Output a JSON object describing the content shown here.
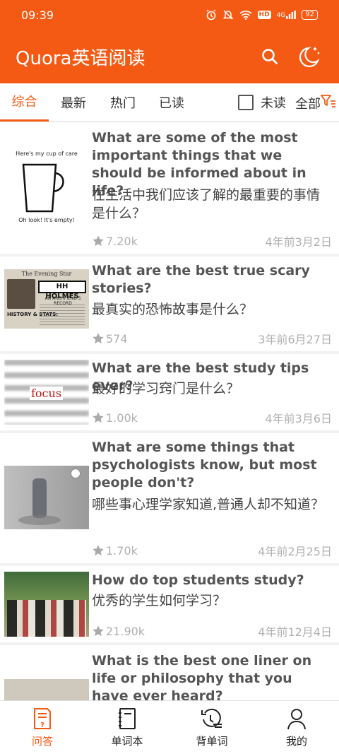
{
  "status": {
    "time": "09:39",
    "hd": "HD",
    "signal": "4G",
    "battery": "92"
  },
  "appbar": {
    "title": "Quora英语阅读",
    "search_icon": "search-icon",
    "night_icon": "moon-stars-icon"
  },
  "tabs": [
    {
      "label": "综合",
      "active": true
    },
    {
      "label": "最新"
    },
    {
      "label": "热门"
    },
    {
      "label": "已读"
    }
  ],
  "unread_label": "未读",
  "filter_label": "全部",
  "articles": [
    {
      "en": "What are some of the most important things that we should be informed about in life?",
      "zh": "在生活中我们应该了解的最重要的事情是什么？",
      "stars": "7.20k",
      "date": "4年前3月2日",
      "thumb_top": "Here's my cup of care",
      "thumb_bottom": "Oh look! It's empty!"
    },
    {
      "en": "What are the best true scary stories?",
      "zh": "最真实的恐怖故事是什么？",
      "stars": "574",
      "date": "3年前6月27日",
      "thumb_header": "The Evening Star",
      "thumb_name": "HH HOLMES",
      "thumb_sub": "AN ARCHFIEND'S RECORD",
      "thumb_stats": "HISTORY & STATS:"
    },
    {
      "en": "What are the best study tips ever?",
      "zh": "最好的学习窍门是什么？",
      "stars": "1.00k",
      "date": "4年前3月6日",
      "thumb_focus": "focus"
    },
    {
      "en": "What are some things that psychologists know, but most people don't?",
      "zh": "哪些事心理学家知道,普通人却不知道？",
      "stars": "1.70k",
      "date": "4年前2月25日"
    },
    {
      "en": "How do top students study?",
      "zh": "优秀的学生如何学习？",
      "stars": "21.90k",
      "date": "4年前12月4日"
    },
    {
      "en": "What is the best one liner on life or philosophy that you have ever heard?"
    }
  ],
  "bottom_nav": [
    {
      "label": "问答",
      "icon": "qa-doc-icon",
      "active": true
    },
    {
      "label": "单词本",
      "icon": "notebook-icon"
    },
    {
      "label": "背单词",
      "icon": "review-history-icon"
    },
    {
      "label": "我的",
      "icon": "user-icon"
    }
  ],
  "colors": {
    "accent": "#f45a14"
  }
}
